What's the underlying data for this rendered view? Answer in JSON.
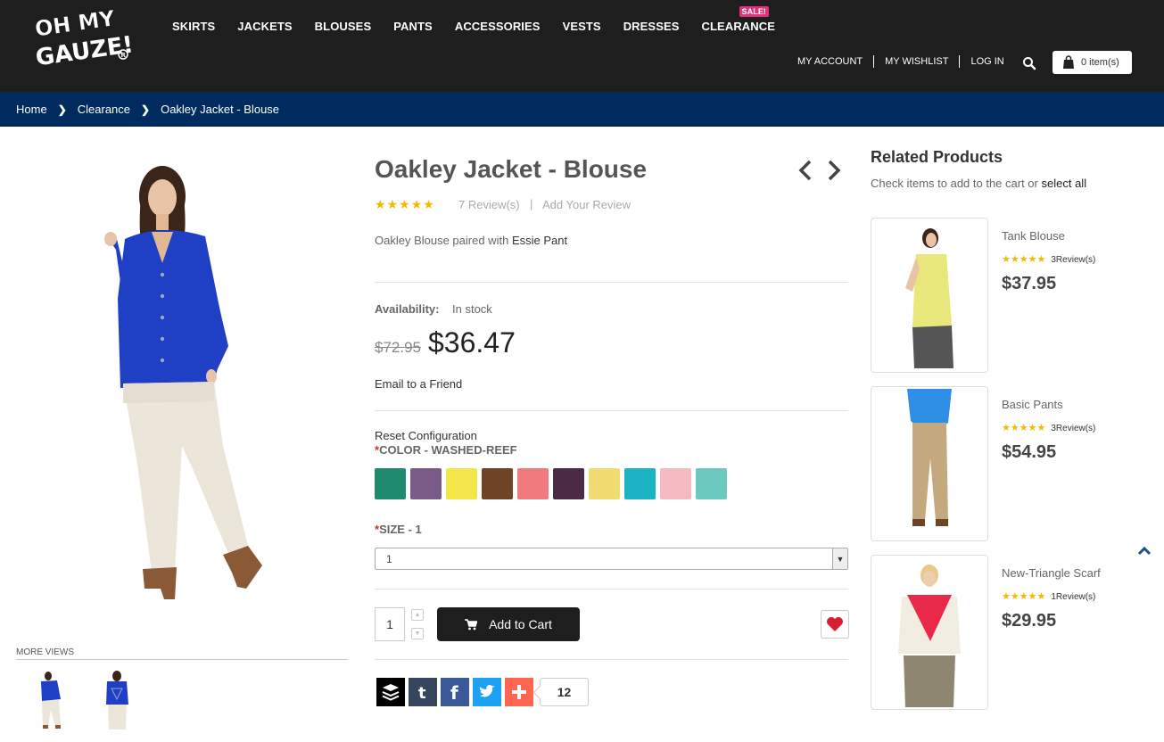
{
  "header": {
    "logo_text": "OH MY GAUZE!",
    "nav": [
      "SKIRTS",
      "JACKETS",
      "BLOUSES",
      "PANTS",
      "ACCESSORIES",
      "VESTS",
      "DRESSES",
      "CLEARANCE"
    ],
    "sale_badge": "SALE!",
    "account_links": [
      "MY ACCOUNT",
      "MY WISHLIST",
      "LOG IN"
    ],
    "cart_label": "0 item(s)"
  },
  "breadcrumb": [
    "Home",
    "Clearance",
    "Oakley Jacket - Blouse"
  ],
  "gallery": {
    "more_views_label": "MORE VIEWS"
  },
  "product": {
    "title": "Oakley Jacket - Blouse",
    "rating": 5,
    "reviews_label": "7 Review(s)",
    "add_review_label": "Add Your Review",
    "desc_prefix": "Oakley Blouse paired with",
    "desc_link": "Essie Pant",
    "availability_label": "Availability:",
    "availability_value": "In stock",
    "old_price": "$72.95",
    "price": "$36.47",
    "email_friend": "Email to a Friend",
    "reset_config": "Reset Configuration",
    "color_label": "COLOR - WASHED-REEF",
    "swatches": [
      "#1f8a6e",
      "#7a5a86",
      "#f2e64a",
      "#6e4326",
      "#f07a7e",
      "#4a2a44",
      "#f0dc70",
      "#1bb3c3",
      "#f5b9c1",
      "#6cc9c0"
    ],
    "size_label": "SIZE - 1",
    "size_selected": "1",
    "qty": "1",
    "add_to_cart": "Add to Cart",
    "share_count": "12"
  },
  "related": {
    "title": "Related Products",
    "sub_prefix": "Check items to add to the cart or",
    "sub_link": "select all",
    "items": [
      {
        "name": "Tank Blouse",
        "reviews": "3Review(s)",
        "price": "$37.95"
      },
      {
        "name": "Basic Pants",
        "reviews": "3Review(s)",
        "price": "$54.95"
      },
      {
        "name": "New-Triangle Scarf",
        "reviews": "1Review(s)",
        "price": "$29.95"
      }
    ]
  },
  "colors": {
    "header_bg": "#1f1e1e",
    "breadcrumb_bg": "#002b5e",
    "star": "#f5b800",
    "sale": "#e0327a"
  }
}
